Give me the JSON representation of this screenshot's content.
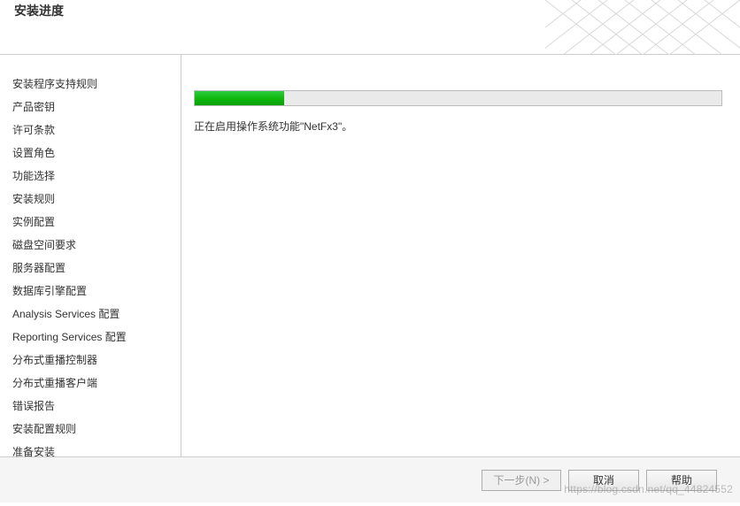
{
  "header": {
    "title": "安装进度"
  },
  "sidebar": {
    "items": [
      "安装程序支持规则",
      "产品密钥",
      "许可条款",
      "设置角色",
      "功能选择",
      "安装规则",
      "实例配置",
      "磁盘空间要求",
      "服务器配置",
      "数据库引擎配置",
      "Analysis Services 配置",
      "Reporting Services 配置",
      "分布式重播控制器",
      "分布式重播客户端",
      "错误报告",
      "安装配置规则",
      "准备安装"
    ]
  },
  "content": {
    "progress_percent": 17,
    "status_text": "正在启用操作系统功能\"NetFx3\"。"
  },
  "footer": {
    "next_label": "下一步(N) >",
    "cancel_label": "取消",
    "help_label": "帮助"
  },
  "watermark": "https://blog.csdn.net/qq_44824552"
}
